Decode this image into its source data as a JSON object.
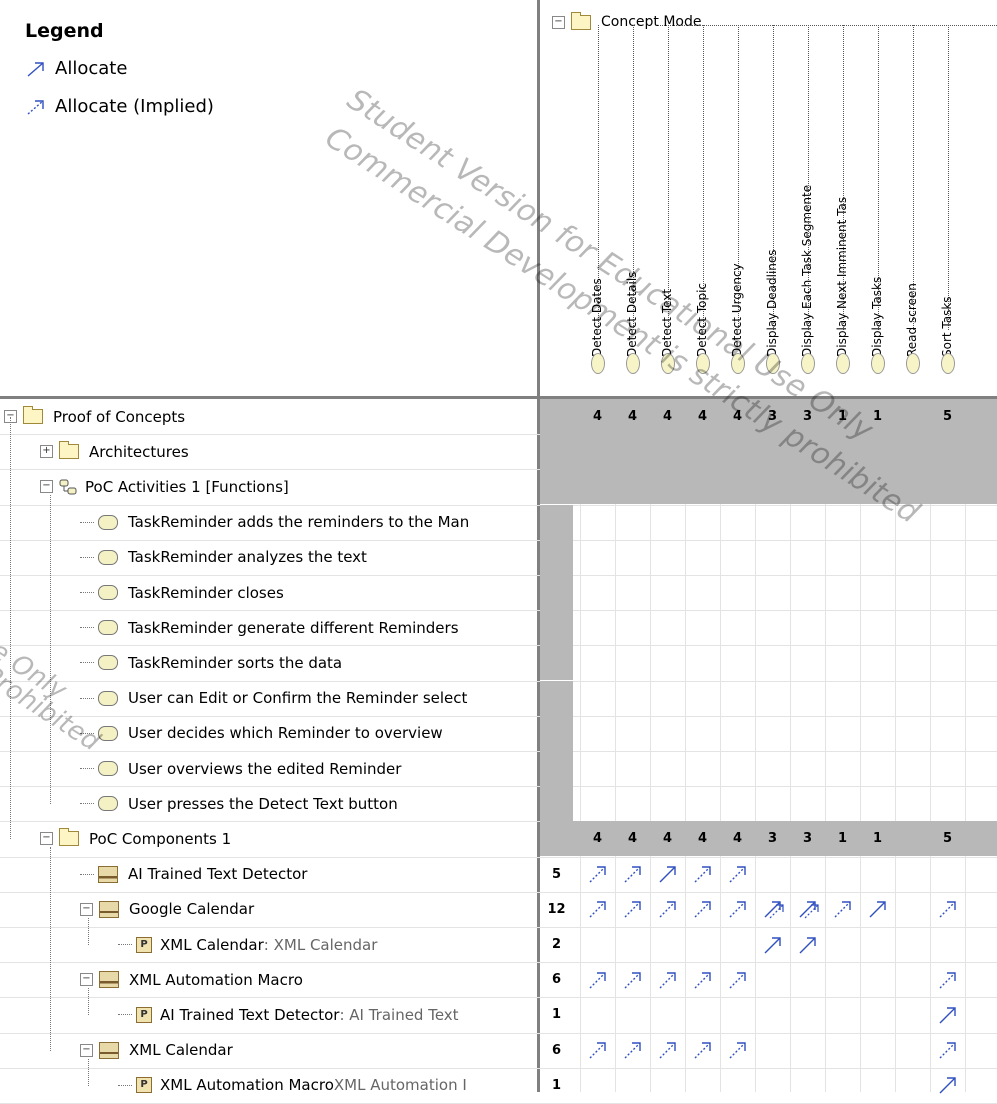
{
  "legend": {
    "title": "Legend",
    "items": [
      {
        "label": "Allocate",
        "icon": "allocate-arrow-icon"
      },
      {
        "label": "Allocate (Implied)",
        "icon": "allocate-implied-arrow-icon"
      }
    ]
  },
  "watermark": {
    "line1": "Student Version for Educational Use Only",
    "line2": "Commercial Development is strictly prohibited",
    "left1": "se Only",
    "left2": "Prohibited"
  },
  "column_root": {
    "label": "Concept Mode"
  },
  "columns": [
    "Detect Dates",
    "Detect Details",
    "Detect Text",
    "Detect Topic",
    "Detect Urgency",
    "Display Deadlines",
    "Display Each Task Segmente",
    "Display Next Imminent Tas",
    "Display Tasks",
    "Read screen",
    "Sort Tasks"
  ],
  "rows": [
    {
      "label": "Proof of Concepts",
      "total": "",
      "cells": [
        "4",
        "4",
        "4",
        "4",
        "4",
        "3",
        "3",
        "1",
        "1",
        "",
        "5"
      ]
    },
    {
      "label": "Architectures",
      "total": "",
      "cells": [
        "",
        "",
        "",
        "",
        "",
        "",
        "",
        "",
        "",
        "",
        ""
      ]
    },
    {
      "label": "PoC Activities 1 [Functions]",
      "total": "",
      "cells": [
        "",
        "",
        "",
        "",
        "",
        "",
        "",
        "",
        "",
        "",
        ""
      ]
    },
    {
      "label": "TaskReminder adds the reminders to the Man",
      "total": "",
      "cells": []
    },
    {
      "label": "TaskReminder analyzes the text",
      "total": "",
      "cells": []
    },
    {
      "label": "TaskReminder closes",
      "total": "",
      "cells": []
    },
    {
      "label": "TaskReminder generate different Reminders",
      "total": "",
      "cells": []
    },
    {
      "label": "TaskReminder sorts the data",
      "total": "",
      "cells": []
    },
    {
      "label": "User can Edit or Confirm the Reminder select",
      "total": "",
      "cells": []
    },
    {
      "label": "User decides which Reminder to overview",
      "total": "",
      "cells": []
    },
    {
      "label": "User overviews the edited Reminder",
      "total": "",
      "cells": []
    },
    {
      "label": "User presses the Detect Text button",
      "total": "",
      "cells": []
    },
    {
      "label": "PoC Components 1",
      "total": "",
      "cells": [
        "4",
        "4",
        "4",
        "4",
        "4",
        "3",
        "3",
        "1",
        "1",
        "",
        "5"
      ]
    },
    {
      "label": "AI Trained Text Detector",
      "total": "5",
      "cells": [
        "I",
        "I",
        "A",
        "I",
        "I",
        "",
        "",
        "",
        "",
        "",
        ""
      ]
    },
    {
      "label": "Google Calendar",
      "total": "12",
      "cells": [
        "I",
        "I",
        "I",
        "I",
        "I",
        "AI",
        "AI",
        "I",
        "A",
        "",
        "I"
      ]
    },
    {
      "label": "XML Calendar",
      "extra": ": XML Calendar",
      "total": "2",
      "cells": [
        "",
        "",
        "",
        "",
        "",
        "A",
        "A",
        "",
        "",
        "",
        ""
      ]
    },
    {
      "label": "XML Automation Macro",
      "total": "6",
      "cells": [
        "I",
        "I",
        "I",
        "I",
        "I",
        "",
        "",
        "",
        "",
        "",
        "I"
      ]
    },
    {
      "label": "AI Trained Text Detector",
      "extra": ": AI Trained Text",
      "total": "1",
      "cells": [
        "",
        "",
        "",
        "",
        "",
        "",
        "",
        "",
        "",
        "",
        "A"
      ]
    },
    {
      "label": "XML Calendar",
      "total": "6",
      "cells": [
        "I",
        "I",
        "I",
        "I",
        "I",
        "",
        "",
        "",
        "",
        "",
        "I"
      ]
    },
    {
      "label": "XML Automation Macro",
      "extra": "XML Automation I",
      "total": "1",
      "cells": [
        "",
        "",
        "",
        "",
        "",
        "",
        "",
        "",
        "",
        "",
        "A"
      ]
    }
  ]
}
